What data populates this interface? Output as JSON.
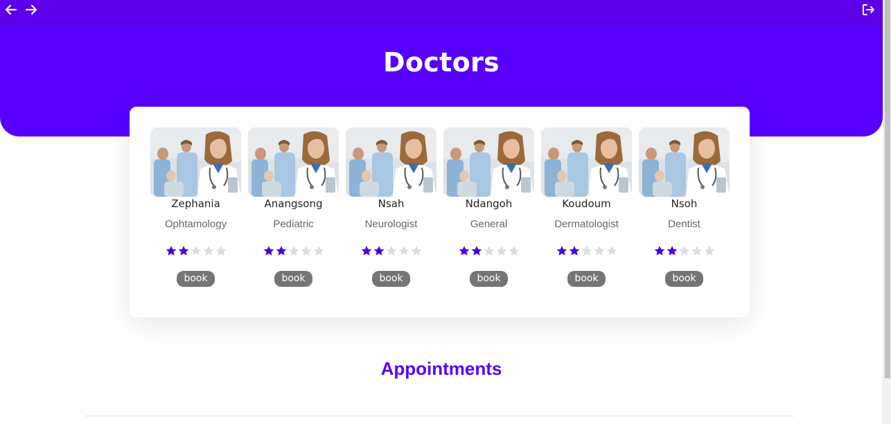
{
  "nav": {
    "back_icon": "arrow-left-icon",
    "forward_icon": "arrow-right-icon",
    "logout_icon": "logout-icon"
  },
  "hero": {
    "title": "Doctors",
    "color": "#5800ff"
  },
  "doctors": [
    {
      "name": "Zephania",
      "specialty": "Ophtamology",
      "rating": 2,
      "max_rating": 5,
      "book_label": "book"
    },
    {
      "name": "Anangsong",
      "specialty": "Pediatric",
      "rating": 2,
      "max_rating": 5,
      "book_label": "book"
    },
    {
      "name": "Nsah",
      "specialty": "Neurologist",
      "rating": 2,
      "max_rating": 5,
      "book_label": "book"
    },
    {
      "name": "Ndangoh",
      "specialty": "General",
      "rating": 2,
      "max_rating": 5,
      "book_label": "book"
    },
    {
      "name": "Koudoum",
      "specialty": "Dermatologist",
      "rating": 2,
      "max_rating": 5,
      "book_label": "book"
    },
    {
      "name": "Nsoh",
      "specialty": "Dentist",
      "rating": 2,
      "max_rating": 5,
      "book_label": "book"
    }
  ],
  "appointments": {
    "title": "Appointments"
  },
  "colors": {
    "accent": "#5800ff",
    "star_filled": "#4a00e0",
    "star_empty": "#dcdcdc",
    "button": "#757575"
  }
}
